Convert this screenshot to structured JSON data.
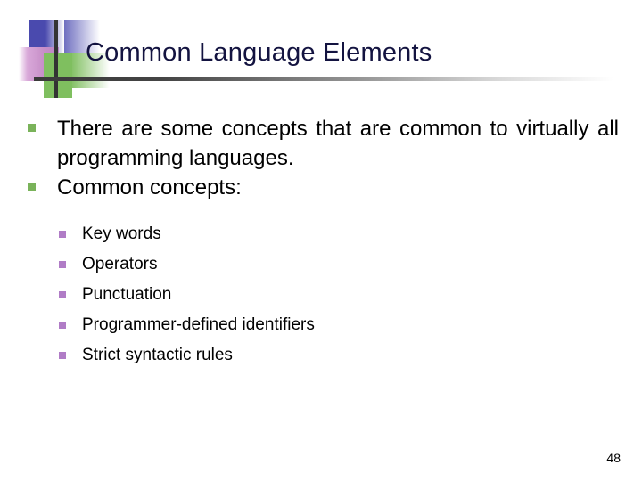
{
  "slide": {
    "title": "Common Language Elements",
    "page_number": "48",
    "colors": {
      "title": "#131340",
      "ornament_blue": "#4a4aae",
      "ornament_green": "#7fbf5f",
      "ornament_pink": "#c78fc8",
      "bullet_level1": "#7ab35a",
      "bullet_level2": "#b07cc6",
      "body_text": "#000000",
      "background": "#ffffff"
    }
  },
  "content": {
    "bullets": [
      {
        "text": "There are some concepts that are common to virtually all programming languages.",
        "justified": true
      },
      {
        "text": "Common concepts:",
        "justified": false
      }
    ],
    "sub_bullets": [
      {
        "text": "Key words"
      },
      {
        "text": "Operators"
      },
      {
        "text": "Punctuation"
      },
      {
        "text": "Programmer-defined identifiers"
      },
      {
        "text": "Strict syntactic rules"
      }
    ]
  }
}
